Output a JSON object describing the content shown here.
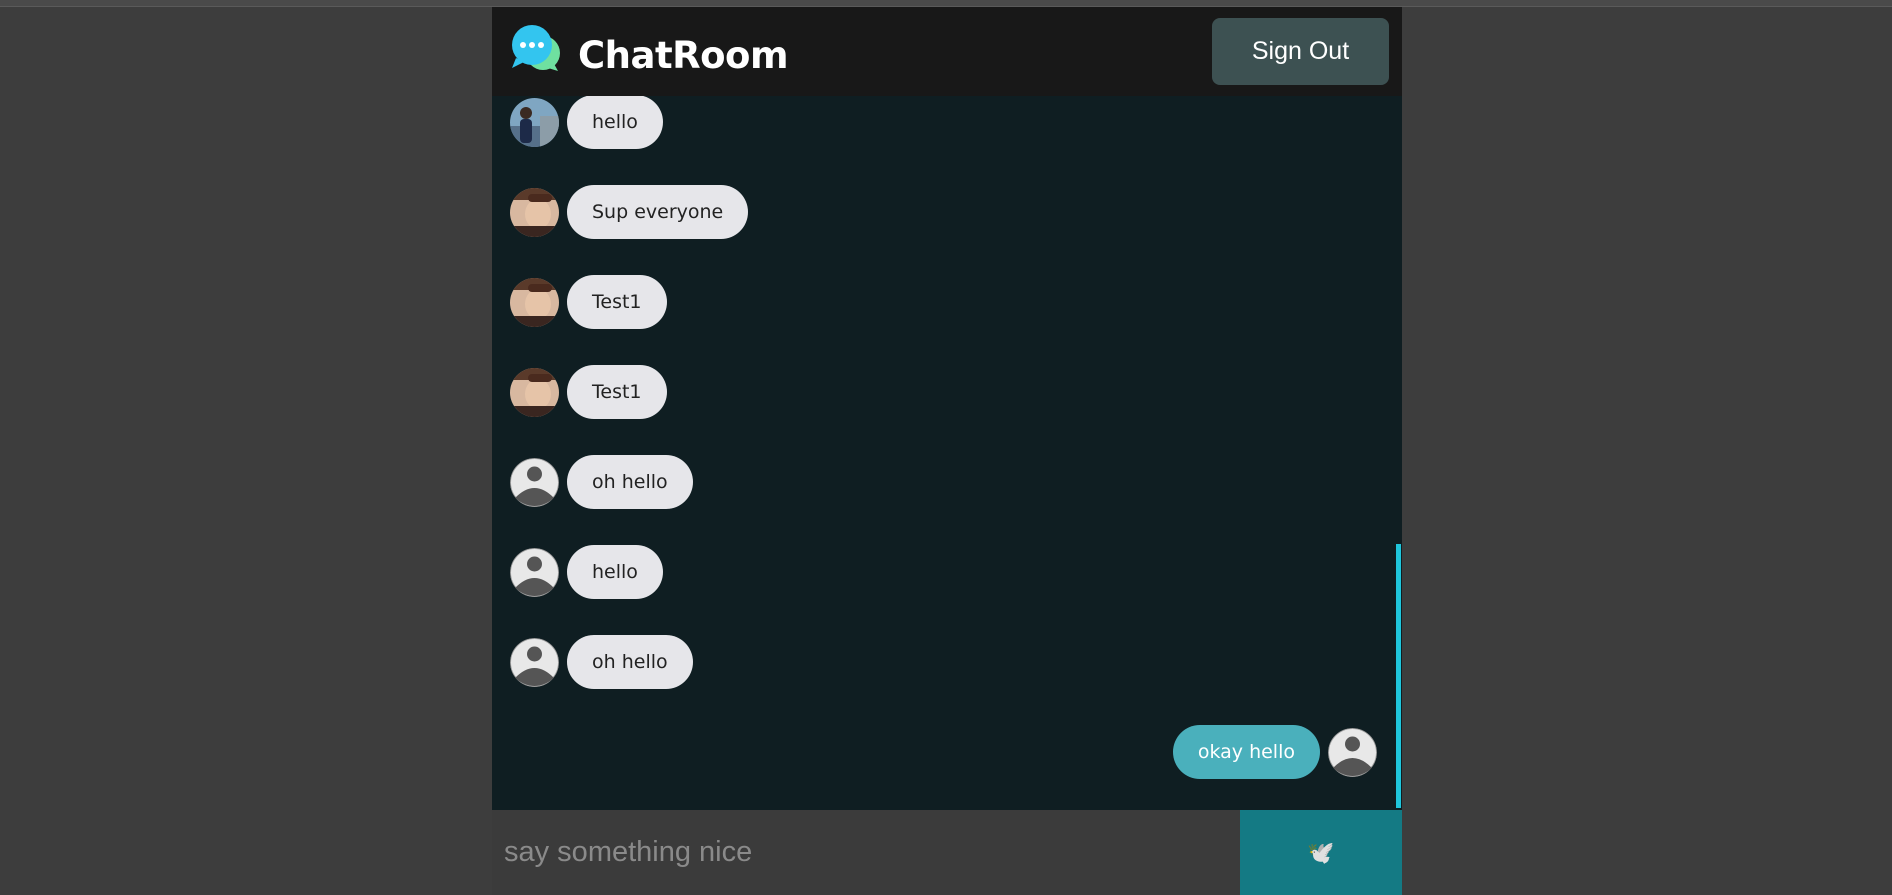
{
  "header": {
    "title": "ChatRoom",
    "logo_icon": "chat-bubbles-icon",
    "signout_label": "Sign Out"
  },
  "messages": [
    {
      "text": "hello",
      "avatar": "photo-man-outdoor",
      "direction": "received"
    },
    {
      "text": "Sup everyone",
      "avatar": "photo-man-face",
      "direction": "received"
    },
    {
      "text": "Test1",
      "avatar": "photo-man-face",
      "direction": "received"
    },
    {
      "text": "Test1",
      "avatar": "photo-man-face",
      "direction": "received"
    },
    {
      "text": "oh hello",
      "avatar": "default-user",
      "direction": "received"
    },
    {
      "text": "hello",
      "avatar": "default-user",
      "direction": "received"
    },
    {
      "text": "oh hello",
      "avatar": "default-user",
      "direction": "received"
    },
    {
      "text": "okay hello",
      "avatar": "default-user",
      "direction": "sent"
    }
  ],
  "composer": {
    "placeholder": "say something nice",
    "value": "",
    "send_icon": "dove-icon",
    "send_glyph": "🕊️"
  },
  "colors": {
    "page_bg": "#3d3d3d",
    "chat_bg": "#0f1e22",
    "header_bg": "#181818",
    "received_bubble": "#e6e6ea",
    "sent_bubble": "#4ab0bc",
    "send_button": "#147a84",
    "signout_button": "#3d5152",
    "scrollbar": "#1fc6dc"
  }
}
